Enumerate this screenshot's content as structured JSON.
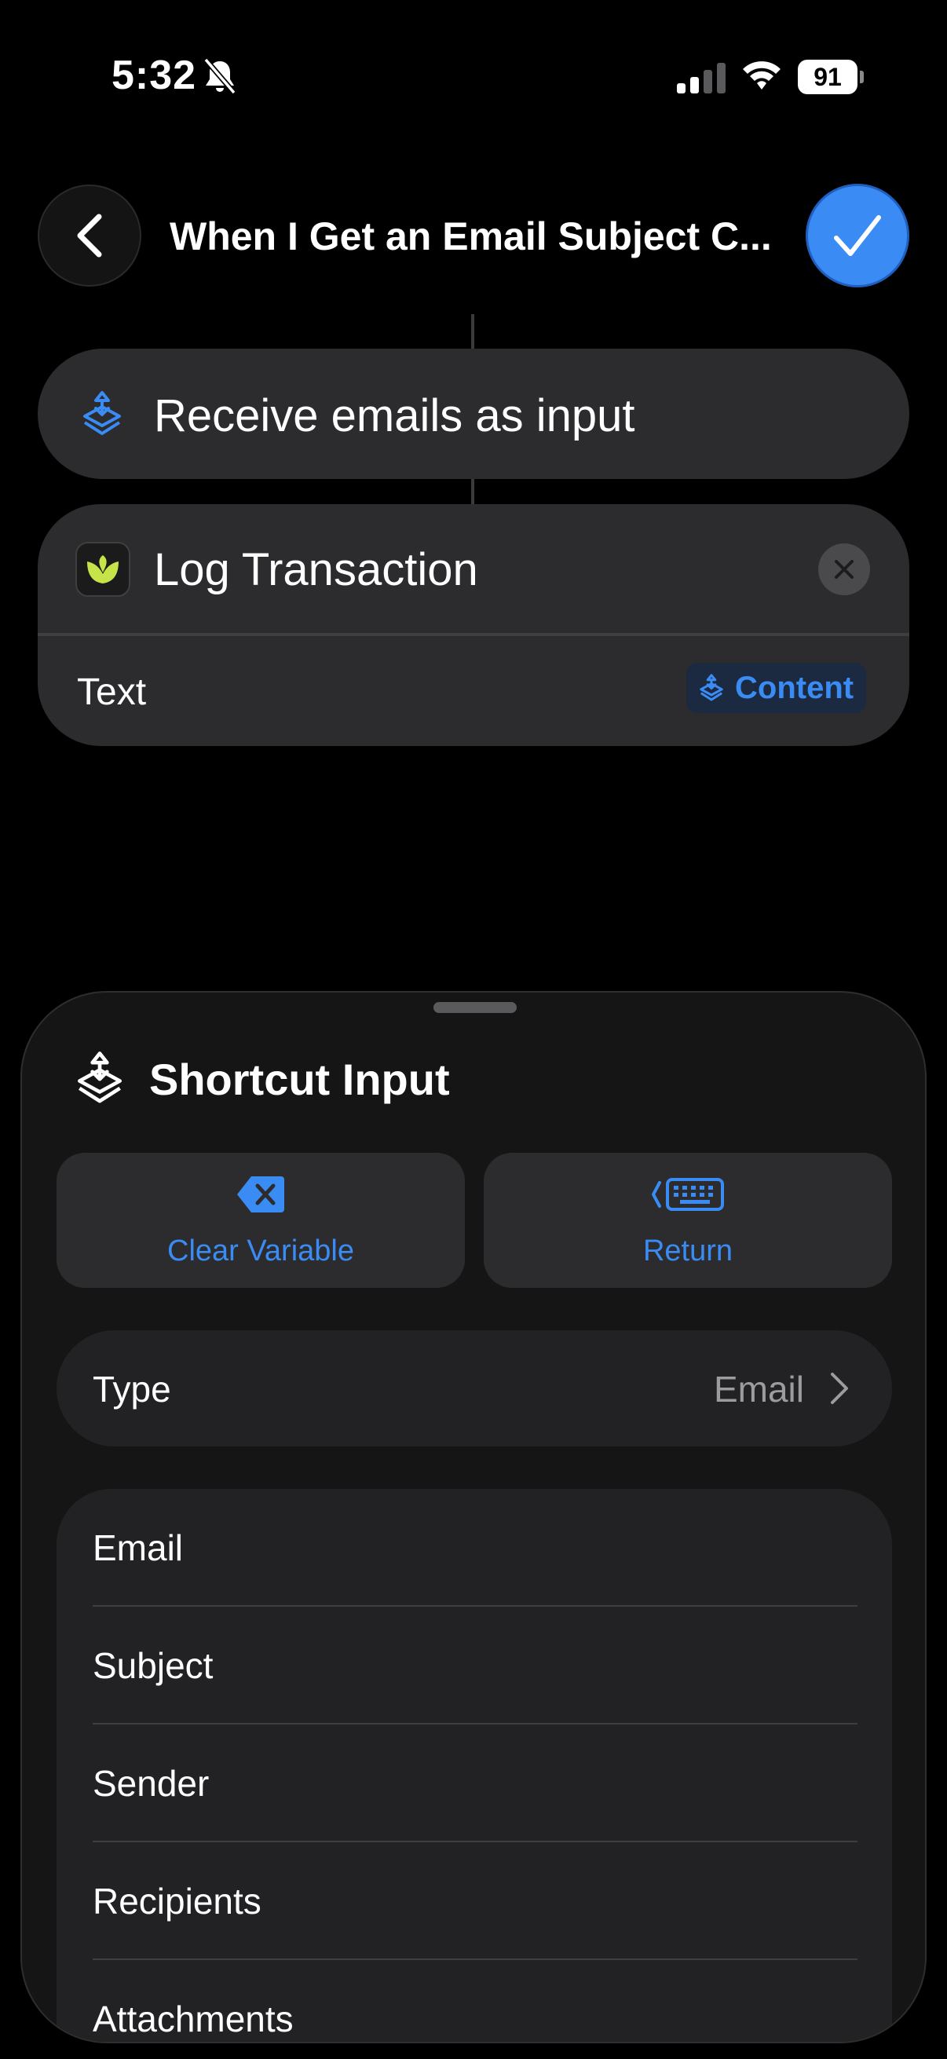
{
  "status_bar": {
    "time": "5:32",
    "battery_level": "91"
  },
  "header": {
    "title": "When I Get an Email Subject C..."
  },
  "actions": {
    "receive_label": "Receive emails as input",
    "log_title": "Log Transaction",
    "param_label": "Text",
    "content_token": "Content"
  },
  "sheet": {
    "title": "Shortcut Input",
    "clear_label": "Clear Variable",
    "return_label": "Return",
    "type_label": "Type",
    "type_value": "Email",
    "items": [
      "Email",
      "Subject",
      "Sender",
      "Recipients",
      "Attachments"
    ]
  },
  "colors": {
    "accent": "#3a8cf4",
    "card": "#2c2c2e",
    "sheet": "#151515",
    "app_icon_green": "#c6e34a"
  }
}
